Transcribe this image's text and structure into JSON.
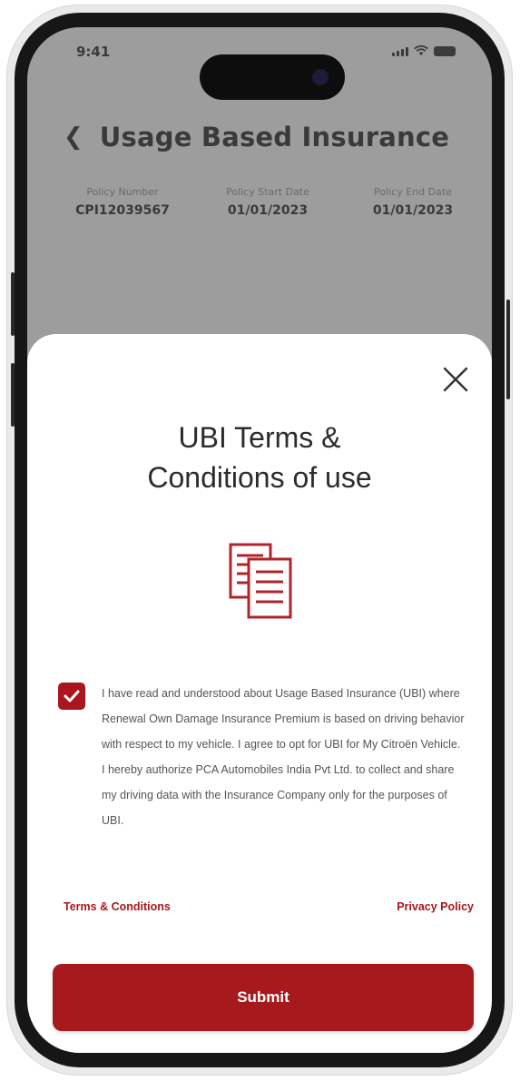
{
  "status_bar": {
    "time": "9:41",
    "icons": [
      "signal-icon",
      "wifi-icon",
      "battery-icon"
    ]
  },
  "header": {
    "back_icon": "chevron-left-icon",
    "title": "Usage Based Insurance"
  },
  "policy": [
    {
      "label": "Policy Number",
      "value": "CPI12039567"
    },
    {
      "label": "Policy Start Date",
      "value": "01/01/2023"
    },
    {
      "label": "Policy End Date",
      "value": "01/01/2023"
    }
  ],
  "modal": {
    "close_icon": "close-icon",
    "title_line1": "UBI Terms &",
    "title_line2": "Conditions of use",
    "document_icon": "documents-icon",
    "checkbox_checked": true,
    "consent_text": "I have read and understood about Usage Based Insurance (UBI) where Renewal Own Damage Insurance Premium is based on driving behavior with respect to my vehicle. I agree to opt for UBI for My Citroën Vehicle. I hereby authorize PCA Automobiles India Pvt Ltd. to collect and share my driving data with the Insurance Company only for the purposes of UBI.",
    "terms_link": "Terms & Conditions",
    "privacy_link": "Privacy Policy",
    "submit_label": "Submit"
  },
  "colors": {
    "accent": "#a61a1e",
    "overlay": "#9d9d9d",
    "sheet": "#ffffff"
  }
}
